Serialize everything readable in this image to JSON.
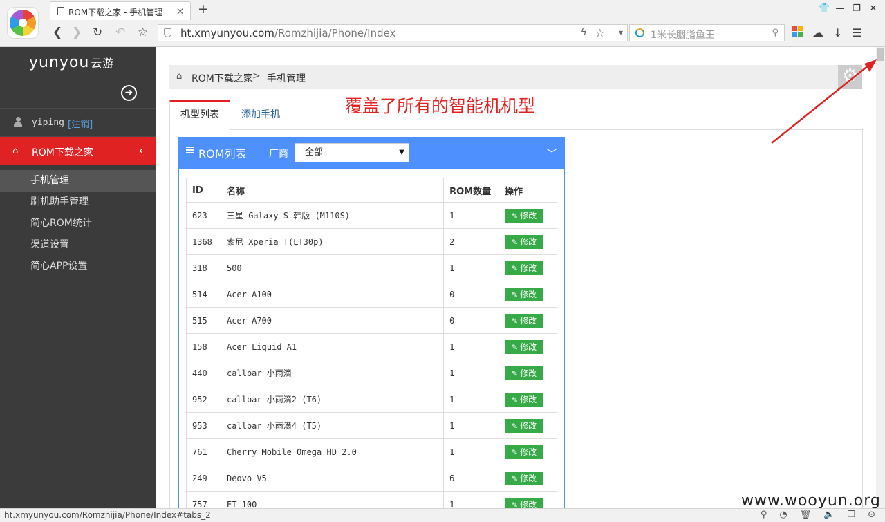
{
  "browser": {
    "tab_title": "ROM下载之家 - 手机管理",
    "tab_close": "×",
    "new_tab": "+",
    "url_host": "ht.xmyunyou.com",
    "url_path": "/Romzhijia/Phone/Index",
    "search_text": "1米长胭脂鱼王",
    "window_buttons": [
      "👕",
      "—",
      "❐",
      "✕"
    ],
    "nav": {
      "back": "❮",
      "forward": "❯",
      "reload": "↻",
      "undo": "↶",
      "bookmark": "☆"
    },
    "status_url": "ht.xmyunyou.com/Romzhijia/Phone/Index#tabs_2"
  },
  "sidebar": {
    "brand": "yunyou",
    "brand_cn": "云游",
    "username": "yiping",
    "logout": "[注销]",
    "active_menu": "ROM下载之家",
    "submenu": [
      {
        "label": "手机管理",
        "active": true
      },
      {
        "label": "刷机助手管理",
        "active": false
      },
      {
        "label": "简心ROM统计",
        "active": false
      },
      {
        "label": "渠道设置",
        "active": false
      },
      {
        "label": "简心APP设置",
        "active": false
      }
    ]
  },
  "breadcrumb": {
    "root": "ROM下载之家",
    "separator": ">",
    "current": "手机管理"
  },
  "tabs": {
    "list": "机型列表",
    "add": "添加手机"
  },
  "annotation": "覆盖了所有的智能机机型",
  "portlet": {
    "title": "ROM列表",
    "vendor_label": "厂商",
    "vendor_selected": "全部",
    "columns": [
      "ID",
      "名称",
      "ROM数量",
      "操作"
    ],
    "edit_label": "修改",
    "rows": [
      {
        "id": "623",
        "name": "三星 Galaxy S 韩版 (M110S)",
        "count": "1"
      },
      {
        "id": "1368",
        "name": "索尼 Xperia T(LT30p)",
        "count": "2"
      },
      {
        "id": "318",
        "name": "500",
        "count": "1"
      },
      {
        "id": "514",
        "name": "Acer A100",
        "count": "0"
      },
      {
        "id": "515",
        "name": "Acer A700",
        "count": "0"
      },
      {
        "id": "158",
        "name": "Acer Liquid A1",
        "count": "1"
      },
      {
        "id": "440",
        "name": "callbar 小雨滴",
        "count": "1"
      },
      {
        "id": "952",
        "name": "callbar 小雨滴2 (T6)",
        "count": "1"
      },
      {
        "id": "953",
        "name": "callbar 小雨滴4 (T5)",
        "count": "1"
      },
      {
        "id": "761",
        "name": "Cherry Mobile Omega HD 2.0",
        "count": "1"
      },
      {
        "id": "249",
        "name": "Deovo V5",
        "count": "6"
      },
      {
        "id": "757",
        "name": "ET 100",
        "count": "1"
      }
    ]
  },
  "watermark": "www.wooyun.org",
  "colors": {
    "accent_red": "#e02222",
    "portlet_blue": "#4d90fe",
    "edit_green": "#35aa47",
    "sidebar_bg": "#3b3b3b"
  }
}
